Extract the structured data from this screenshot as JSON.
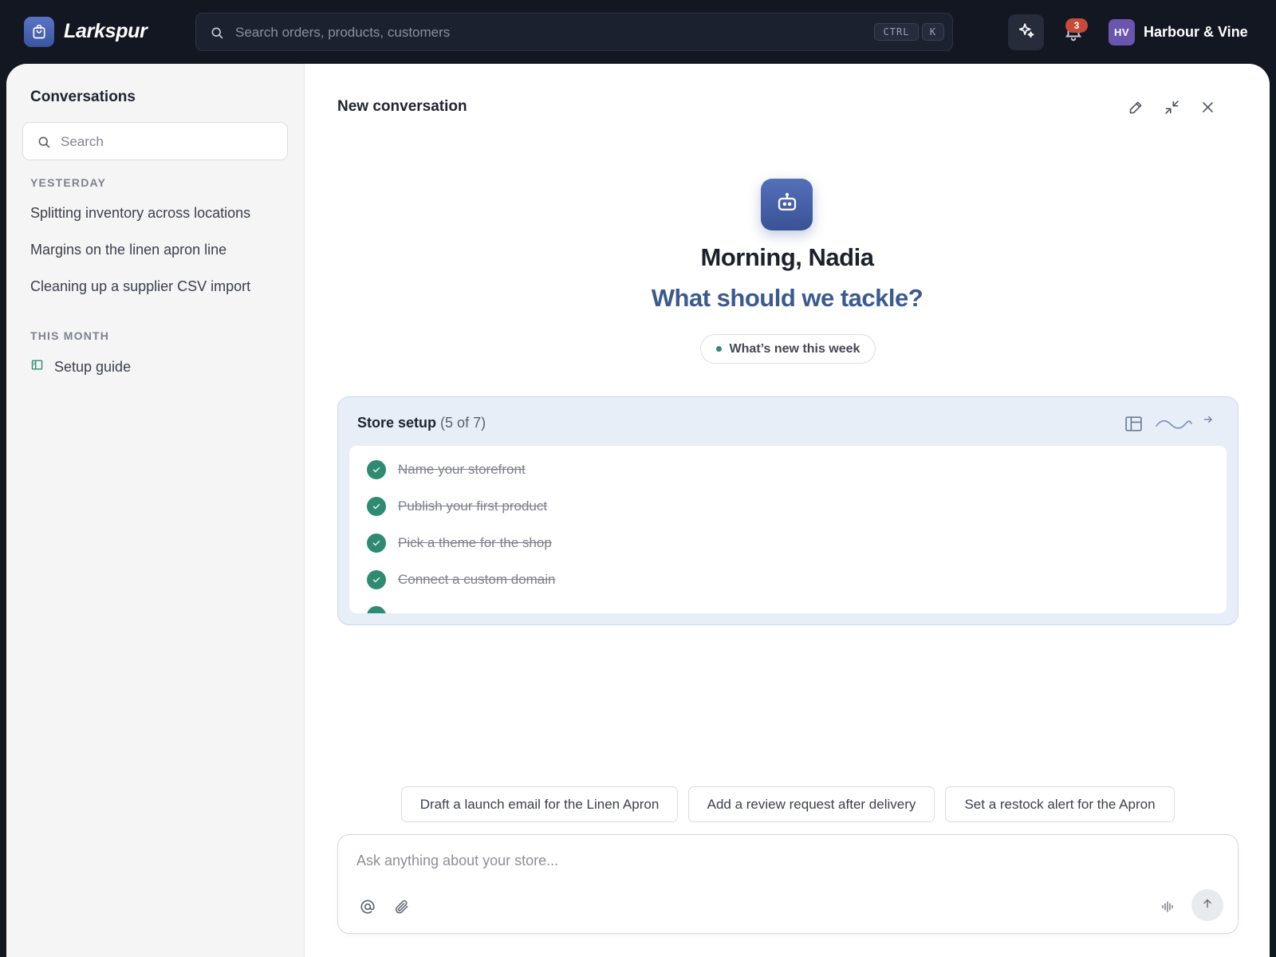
{
  "topbar": {
    "app_name": "Larkspur",
    "search_placeholder": "Search orders, products, customers",
    "shortcut_ctrl": "CTRL",
    "shortcut_key": "K",
    "notification_count": "3",
    "avatar_initials": "HV",
    "store_name": "Harbour & Vine"
  },
  "sidebar": {
    "title": "Conversations",
    "search_placeholder": "Search",
    "sections": [
      {
        "label": "YESTERDAY",
        "items": [
          "Splitting inventory across locations",
          "Margins on the linen apron line",
          "Cleaning up a supplier CSV import"
        ]
      },
      {
        "label": "THIS MONTH",
        "items": [
          "Setup guide"
        ]
      }
    ]
  },
  "main": {
    "title": "New conversation",
    "greeting": "Morning, Nadia",
    "prompt": "What should we tackle?",
    "whats_new": "What’s new this week",
    "setup": {
      "title": "Store setup",
      "count": "(5 of 7)",
      "completed": 5,
      "total": 7,
      "tasks": [
        "Name your storefront",
        "Publish your first product",
        "Pick a theme for the shop",
        "Connect a custom domain"
      ]
    },
    "suggestions": [
      "Draft a launch email for the Linen Apron",
      "Add a review request after delivery",
      "Set a restock alert for the Apron"
    ],
    "composer_placeholder": "Ask anything about your store..."
  },
  "colors": {
    "topbar_bg": "#131722",
    "accent": "#3b54a0",
    "prompt_text": "#3b5a90",
    "check_green": "#2f8a72",
    "badge_red": "#c84a3a",
    "avatar_purple": "#6a55b0"
  },
  "icons": [
    "shopping-bag-icon",
    "search-icon",
    "sparkle-icon",
    "bell-icon",
    "book-icon",
    "edit-icon",
    "collapse-icon",
    "close-icon",
    "robot-icon",
    "panel-icon",
    "wave-icon",
    "arrow-right-icon",
    "check-icon",
    "at-icon",
    "paperclip-icon",
    "waveform-icon",
    "arrow-up-icon"
  ]
}
